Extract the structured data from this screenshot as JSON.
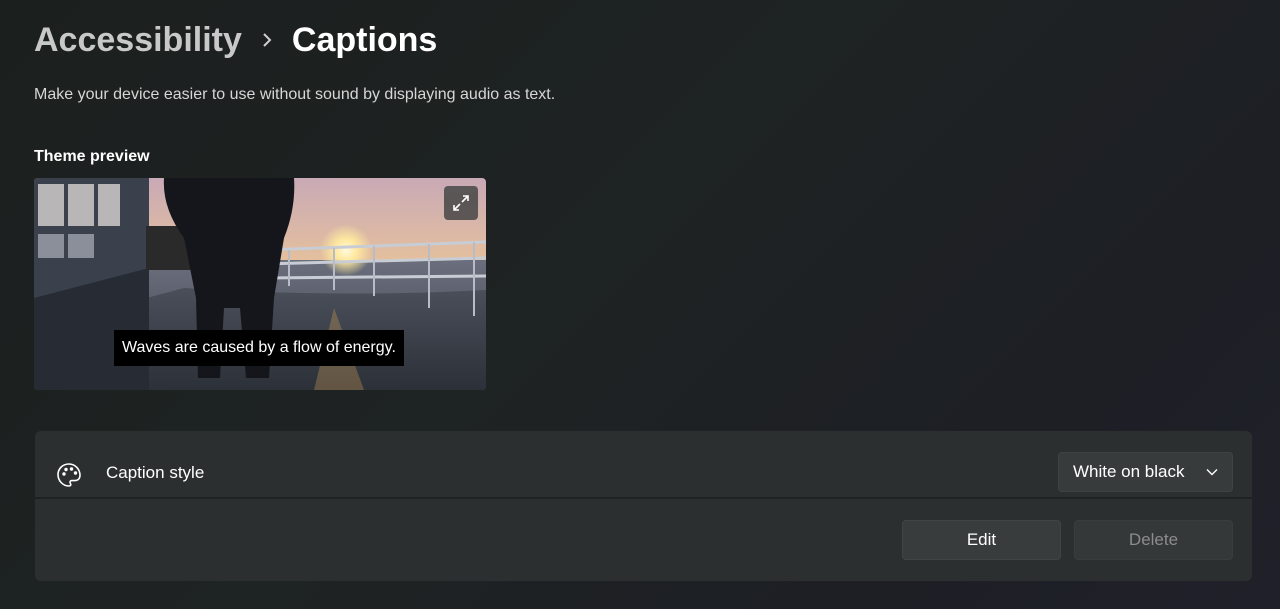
{
  "breadcrumb": {
    "parent": "Accessibility",
    "separator": "›",
    "current": "Captions"
  },
  "description": "Make your device easier to use without sound by displaying audio as text.",
  "theme_preview": {
    "label": "Theme preview",
    "caption_text": "Waves are caused by a flow of energy.",
    "expand_icon": "expand-icon",
    "image_subject": "person on ship deck at sunset"
  },
  "caption_style": {
    "icon": "palette-icon",
    "label": "Caption style",
    "selected_value": "White on black",
    "dropdown_icon": "chevron-down-icon",
    "edit_label": "Edit",
    "delete_label": "Delete",
    "delete_enabled": false
  },
  "colors": {
    "background": "#1e2323",
    "card": "#2b2f30",
    "button": "#383c3d",
    "disabled_text": "#8a8c8d"
  }
}
